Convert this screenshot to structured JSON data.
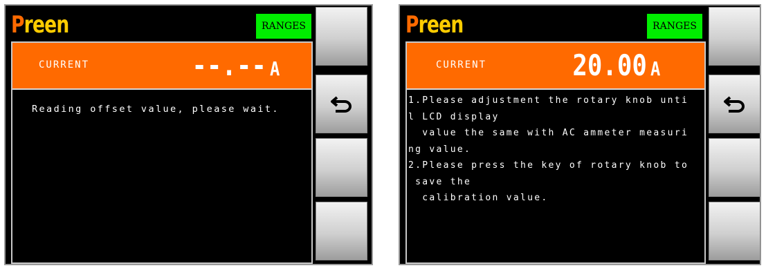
{
  "left": {
    "brand": "Preen",
    "ranges_label": "RANGES",
    "current_label": "CURRENT",
    "current_value": "--.--",
    "current_unit": "A",
    "message": "Reading offset value, please wait."
  },
  "right": {
    "brand": "Preen",
    "ranges_label": "RANGES",
    "current_label": "CURRENT",
    "current_value": "20.00",
    "current_unit": "A",
    "message_lines": [
      "1.Please adjustment the rotary knob unti",
      "l LCD display",
      "  value the same with AC ammeter measuri",
      "ng value.",
      "2.Please press the key of rotary knob to",
      " save the",
      "  calibration value."
    ]
  },
  "colors": {
    "accent_orange": "#ff6a00",
    "ranges_green": "#00ee00",
    "brand_yellow": "#ffcc00"
  },
  "icons": {
    "side_button_2": "back-arrow-icon"
  }
}
